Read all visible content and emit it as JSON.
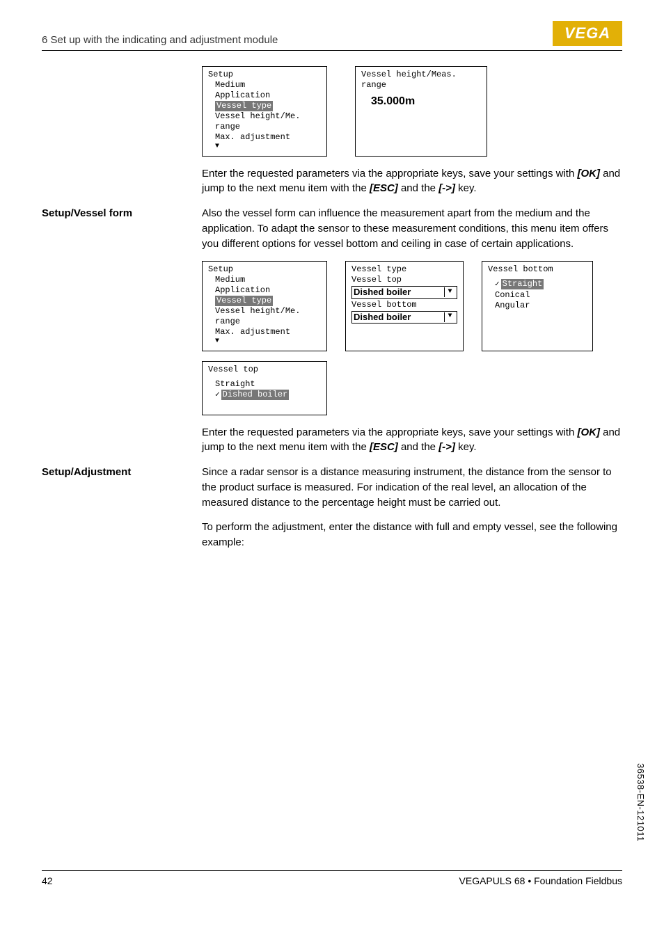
{
  "header": {
    "section_title": "6 Set up with the indicating and adjustment module",
    "logo_text": "VEGA"
  },
  "block1": {
    "screen_setup": {
      "title": "Setup",
      "lines": [
        "Medium",
        "Application",
        "Vessel type",
        "Vessel height/Me. range",
        "Max. adjustment"
      ],
      "highlight_index": 2
    },
    "screen_measrange": {
      "title": "Vessel height/Meas. range",
      "value": "35.000m"
    },
    "para": "Enter the requested parameters via the appropriate keys, save your settings with ",
    "ok": "[OK]",
    "para_mid": " and jump to the next menu item with the ",
    "esc": "[ESC]",
    "para_and": " and the ",
    "arrow": "[->]",
    "para_end": " key."
  },
  "block2": {
    "left_label": "Setup/Vessel form",
    "intro": "Also the vessel form can influence the measurement apart from the medium and the application. To adapt the sensor to these measurement conditions, this menu item offers you different options for vessel bottom and ceiling in case of certain applications.",
    "screen_setup": {
      "title": "Setup",
      "lines": [
        "Medium",
        "Application",
        "Vessel type",
        "Vessel height/Me. range",
        "Max. adjustment"
      ],
      "highlight_index": 2
    },
    "screen_vtype": {
      "title": "Vessel type",
      "sub1": "Vessel top",
      "dd1": "Dished boiler",
      "sub2": "Vessel bottom",
      "dd2": "Dished boiler"
    },
    "screen_vbottom": {
      "title": "Vessel bottom",
      "lines": [
        "Straight",
        "Conical",
        "Angular"
      ],
      "highlight_index": 0
    },
    "screen_vtop": {
      "title": "Vessel top",
      "lines": [
        "Straight",
        "Dished boiler"
      ],
      "highlight_index": 1
    },
    "para": "Enter the requested parameters via the appropriate keys, save your settings with ",
    "ok": "[OK]",
    "para_mid": " and jump to the next menu item with the ",
    "esc": "[ESC]",
    "para_and": " and the ",
    "arrow": "[->]",
    "para_end": " key."
  },
  "block3": {
    "left_label": "Setup/Adjustment",
    "para1": "Since a radar sensor is a distance measuring instrument, the distance from the sensor to the product surface is measured. For indication of the real level, an allocation of the measured distance to the percentage height must be carried out.",
    "para2": "To perform the adjustment, enter the distance with full and empty vessel, see the following example:"
  },
  "footer": {
    "page": "42",
    "product": "VEGAPULS 68 • Foundation Fieldbus",
    "doc_id": "36538-EN-121011"
  }
}
